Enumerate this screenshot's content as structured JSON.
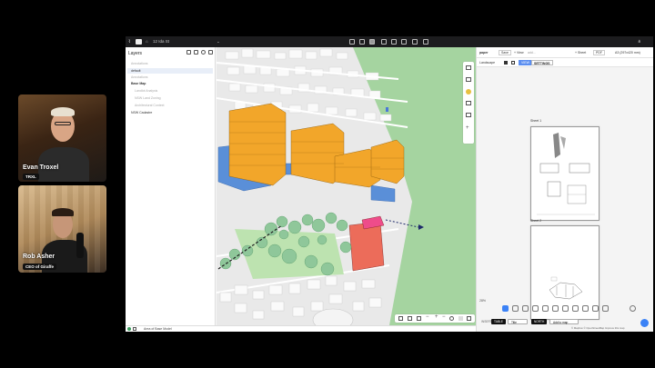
{
  "call": {
    "participants": [
      {
        "name": "Evan Troxel",
        "badge": "TRXL"
      },
      {
        "name": "Rob Asher",
        "badge": "CEO of Giraffe"
      }
    ]
  },
  "app": {
    "project_name": "12 Ida St",
    "layers_panel": {
      "title": "Layers",
      "items": [
        {
          "label": "Annotations",
          "style": "dim"
        },
        {
          "label": "default",
          "style": "selected"
        },
        {
          "label": "Annotations",
          "style": "dim"
        },
        {
          "label": "Base Map",
          "style": "bold"
        },
        {
          "label": "Landlot Analysis",
          "style": "dim"
        },
        {
          "label": "NSW Land Zoning",
          "style": "dim"
        },
        {
          "label": "Architectural Context",
          "style": "dim"
        },
        {
          "label": "NSW Cadastre",
          "style": "normal"
        }
      ]
    },
    "paper": {
      "title": "paper",
      "save_label": "Save",
      "view_label": "+ View",
      "view_placeholder": "add...",
      "sheet_label": "+ Sheet",
      "pdf_label": "PDF",
      "page_size": "A3 (297x420 mm)",
      "orientation": "Landscape",
      "tab_view": "VIEW",
      "tab_settings": "SETTINGS",
      "sheets": [
        "Sheet 1",
        "Sheet 2"
      ],
      "zoom": "28%",
      "footer": {
        "prefix": "INSERT",
        "table_btn": "TABLE",
        "title_dropdown": "Title",
        "north_btn": "NORTH",
        "map_dropdown": "Add to map"
      },
      "attribution": "© Mapbox © OpenStreetMap Improve this map"
    },
    "statusbar": {
      "text": "Area of Base Model"
    }
  }
}
